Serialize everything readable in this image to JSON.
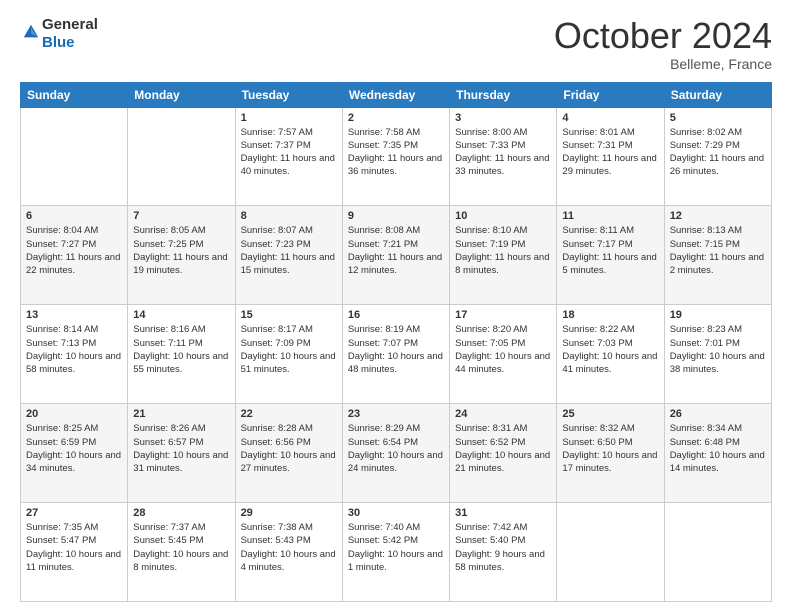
{
  "header": {
    "logo_line1": "General",
    "logo_line2": "Blue",
    "month": "October 2024",
    "location": "Belleme, France"
  },
  "weekdays": [
    "Sunday",
    "Monday",
    "Tuesday",
    "Wednesday",
    "Thursday",
    "Friday",
    "Saturday"
  ],
  "weeks": [
    [
      {
        "day": "",
        "info": ""
      },
      {
        "day": "",
        "info": ""
      },
      {
        "day": "1",
        "info": "Sunrise: 7:57 AM\nSunset: 7:37 PM\nDaylight: 11 hours and 40 minutes."
      },
      {
        "day": "2",
        "info": "Sunrise: 7:58 AM\nSunset: 7:35 PM\nDaylight: 11 hours and 36 minutes."
      },
      {
        "day": "3",
        "info": "Sunrise: 8:00 AM\nSunset: 7:33 PM\nDaylight: 11 hours and 33 minutes."
      },
      {
        "day": "4",
        "info": "Sunrise: 8:01 AM\nSunset: 7:31 PM\nDaylight: 11 hours and 29 minutes."
      },
      {
        "day": "5",
        "info": "Sunrise: 8:02 AM\nSunset: 7:29 PM\nDaylight: 11 hours and 26 minutes."
      }
    ],
    [
      {
        "day": "6",
        "info": "Sunrise: 8:04 AM\nSunset: 7:27 PM\nDaylight: 11 hours and 22 minutes."
      },
      {
        "day": "7",
        "info": "Sunrise: 8:05 AM\nSunset: 7:25 PM\nDaylight: 11 hours and 19 minutes."
      },
      {
        "day": "8",
        "info": "Sunrise: 8:07 AM\nSunset: 7:23 PM\nDaylight: 11 hours and 15 minutes."
      },
      {
        "day": "9",
        "info": "Sunrise: 8:08 AM\nSunset: 7:21 PM\nDaylight: 11 hours and 12 minutes."
      },
      {
        "day": "10",
        "info": "Sunrise: 8:10 AM\nSunset: 7:19 PM\nDaylight: 11 hours and 8 minutes."
      },
      {
        "day": "11",
        "info": "Sunrise: 8:11 AM\nSunset: 7:17 PM\nDaylight: 11 hours and 5 minutes."
      },
      {
        "day": "12",
        "info": "Sunrise: 8:13 AM\nSunset: 7:15 PM\nDaylight: 11 hours and 2 minutes."
      }
    ],
    [
      {
        "day": "13",
        "info": "Sunrise: 8:14 AM\nSunset: 7:13 PM\nDaylight: 10 hours and 58 minutes."
      },
      {
        "day": "14",
        "info": "Sunrise: 8:16 AM\nSunset: 7:11 PM\nDaylight: 10 hours and 55 minutes."
      },
      {
        "day": "15",
        "info": "Sunrise: 8:17 AM\nSunset: 7:09 PM\nDaylight: 10 hours and 51 minutes."
      },
      {
        "day": "16",
        "info": "Sunrise: 8:19 AM\nSunset: 7:07 PM\nDaylight: 10 hours and 48 minutes."
      },
      {
        "day": "17",
        "info": "Sunrise: 8:20 AM\nSunset: 7:05 PM\nDaylight: 10 hours and 44 minutes."
      },
      {
        "day": "18",
        "info": "Sunrise: 8:22 AM\nSunset: 7:03 PM\nDaylight: 10 hours and 41 minutes."
      },
      {
        "day": "19",
        "info": "Sunrise: 8:23 AM\nSunset: 7:01 PM\nDaylight: 10 hours and 38 minutes."
      }
    ],
    [
      {
        "day": "20",
        "info": "Sunrise: 8:25 AM\nSunset: 6:59 PM\nDaylight: 10 hours and 34 minutes."
      },
      {
        "day": "21",
        "info": "Sunrise: 8:26 AM\nSunset: 6:57 PM\nDaylight: 10 hours and 31 minutes."
      },
      {
        "day": "22",
        "info": "Sunrise: 8:28 AM\nSunset: 6:56 PM\nDaylight: 10 hours and 27 minutes."
      },
      {
        "day": "23",
        "info": "Sunrise: 8:29 AM\nSunset: 6:54 PM\nDaylight: 10 hours and 24 minutes."
      },
      {
        "day": "24",
        "info": "Sunrise: 8:31 AM\nSunset: 6:52 PM\nDaylight: 10 hours and 21 minutes."
      },
      {
        "day": "25",
        "info": "Sunrise: 8:32 AM\nSunset: 6:50 PM\nDaylight: 10 hours and 17 minutes."
      },
      {
        "day": "26",
        "info": "Sunrise: 8:34 AM\nSunset: 6:48 PM\nDaylight: 10 hours and 14 minutes."
      }
    ],
    [
      {
        "day": "27",
        "info": "Sunrise: 7:35 AM\nSunset: 5:47 PM\nDaylight: 10 hours and 11 minutes."
      },
      {
        "day": "28",
        "info": "Sunrise: 7:37 AM\nSunset: 5:45 PM\nDaylight: 10 hours and 8 minutes."
      },
      {
        "day": "29",
        "info": "Sunrise: 7:38 AM\nSunset: 5:43 PM\nDaylight: 10 hours and 4 minutes."
      },
      {
        "day": "30",
        "info": "Sunrise: 7:40 AM\nSunset: 5:42 PM\nDaylight: 10 hours and 1 minute."
      },
      {
        "day": "31",
        "info": "Sunrise: 7:42 AM\nSunset: 5:40 PM\nDaylight: 9 hours and 58 minutes."
      },
      {
        "day": "",
        "info": ""
      },
      {
        "day": "",
        "info": ""
      }
    ]
  ]
}
